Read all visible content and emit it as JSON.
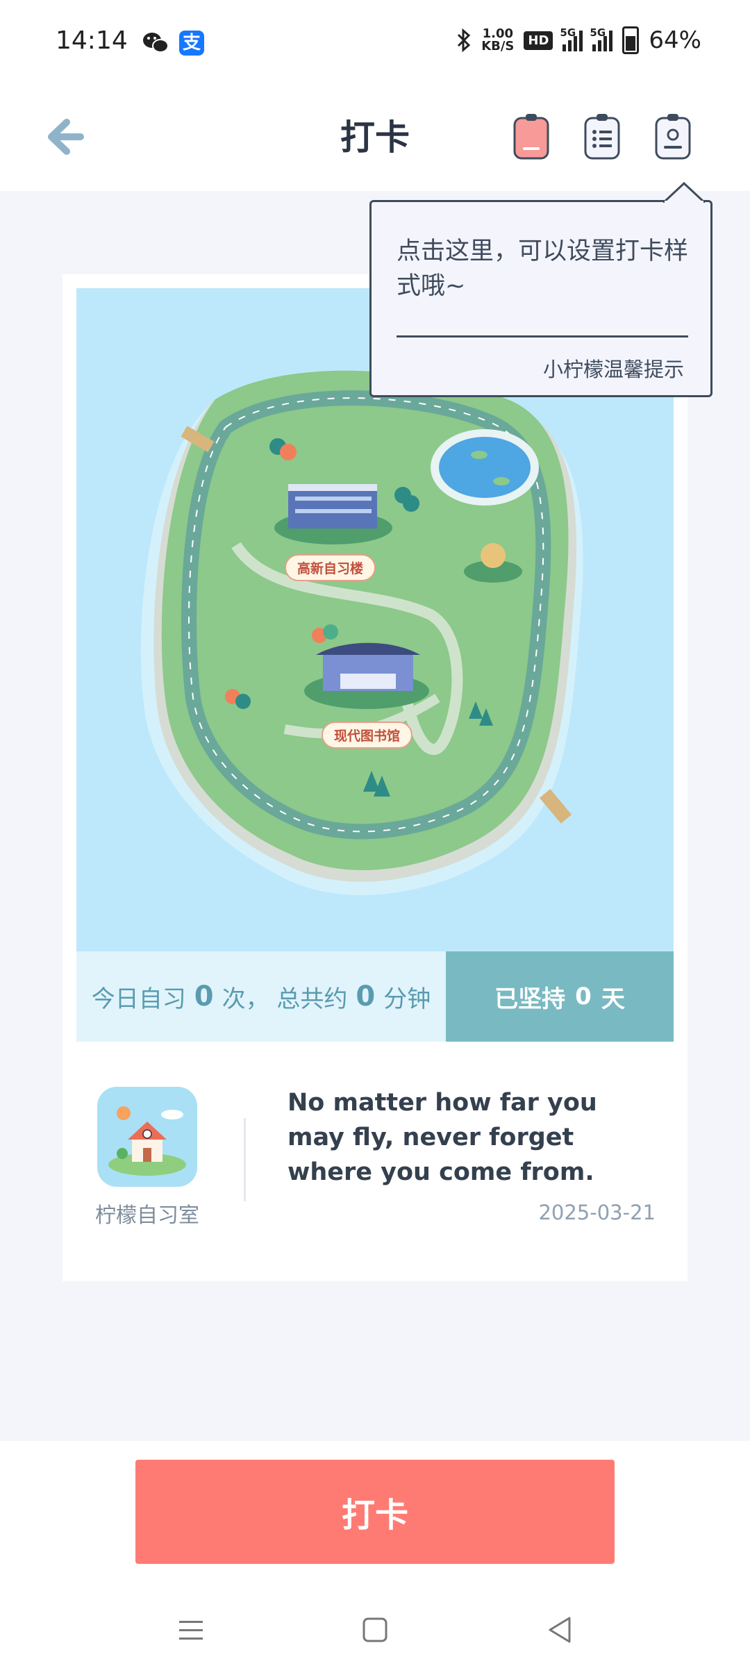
{
  "status_bar": {
    "time": "14:14",
    "net_speed_value": "1.00",
    "net_speed_unit": "KB/S",
    "hd_badge": "HD",
    "signal1_label": "5G",
    "signal2_label": "5G",
    "battery": "64%",
    "icons": [
      "wechat-icon",
      "alipay-icon",
      "bluetooth-icon",
      "signal-icon",
      "battery-icon"
    ]
  },
  "header": {
    "title": "打卡",
    "icons": [
      "back-arrow-icon",
      "pink-clipboard-icon",
      "list-clipboard-icon",
      "badge-clipboard-icon"
    ]
  },
  "tooltip": {
    "text": "点击这里，可以设置打卡样式哦~",
    "signature": "小柠檬温馨提示"
  },
  "map": {
    "label_building": "高新自习楼",
    "label_library": "现代图书馆",
    "colors": {
      "water": "#bde8fb",
      "island": "#8cc98a",
      "road": "#6aa89a"
    }
  },
  "stats": {
    "today_prefix": "今日自习",
    "today_count": "0",
    "today_mid": "次，  总共约",
    "total_minutes": "0",
    "minutes_unit": "分钟",
    "streak_prefix": "已坚持",
    "streak_days": "0",
    "streak_unit": "天"
  },
  "room": {
    "name": "柠檬自习室",
    "quote": "No matter how far you may fly, never forget where you come from.",
    "date": "2025-03-21"
  },
  "action": {
    "checkin_label": "打卡",
    "color": "#fe7b74"
  },
  "nav": {
    "icons": [
      "menu-icon",
      "home-icon",
      "back-icon"
    ]
  }
}
